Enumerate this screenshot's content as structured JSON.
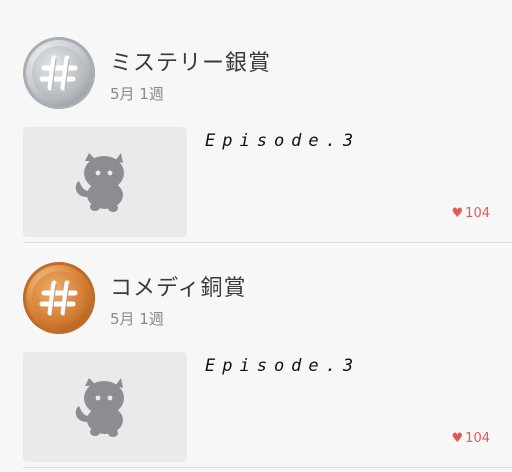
{
  "awards": [
    {
      "medal": "silver",
      "medal_icon": "hash-icon",
      "title": "ミステリー銀賞",
      "period": "5月 1週",
      "episode": "Episode.3",
      "likes": "104",
      "like_icon": "heart-icon",
      "thumbnail_icon": "cat-placeholder-icon"
    },
    {
      "medal": "bronze",
      "medal_icon": "hash-icon",
      "title": "コメディ銅賞",
      "period": "5月 1週",
      "episode": "Episode.3",
      "likes": "104",
      "like_icon": "heart-icon",
      "thumbnail_icon": "cat-placeholder-icon"
    }
  ],
  "colors": {
    "background": "#f7f7f7",
    "thumbnail_bg": "#e9eaec",
    "like": "#e15a5a",
    "silver": "#b4b9be",
    "bronze": "#d07a30"
  }
}
